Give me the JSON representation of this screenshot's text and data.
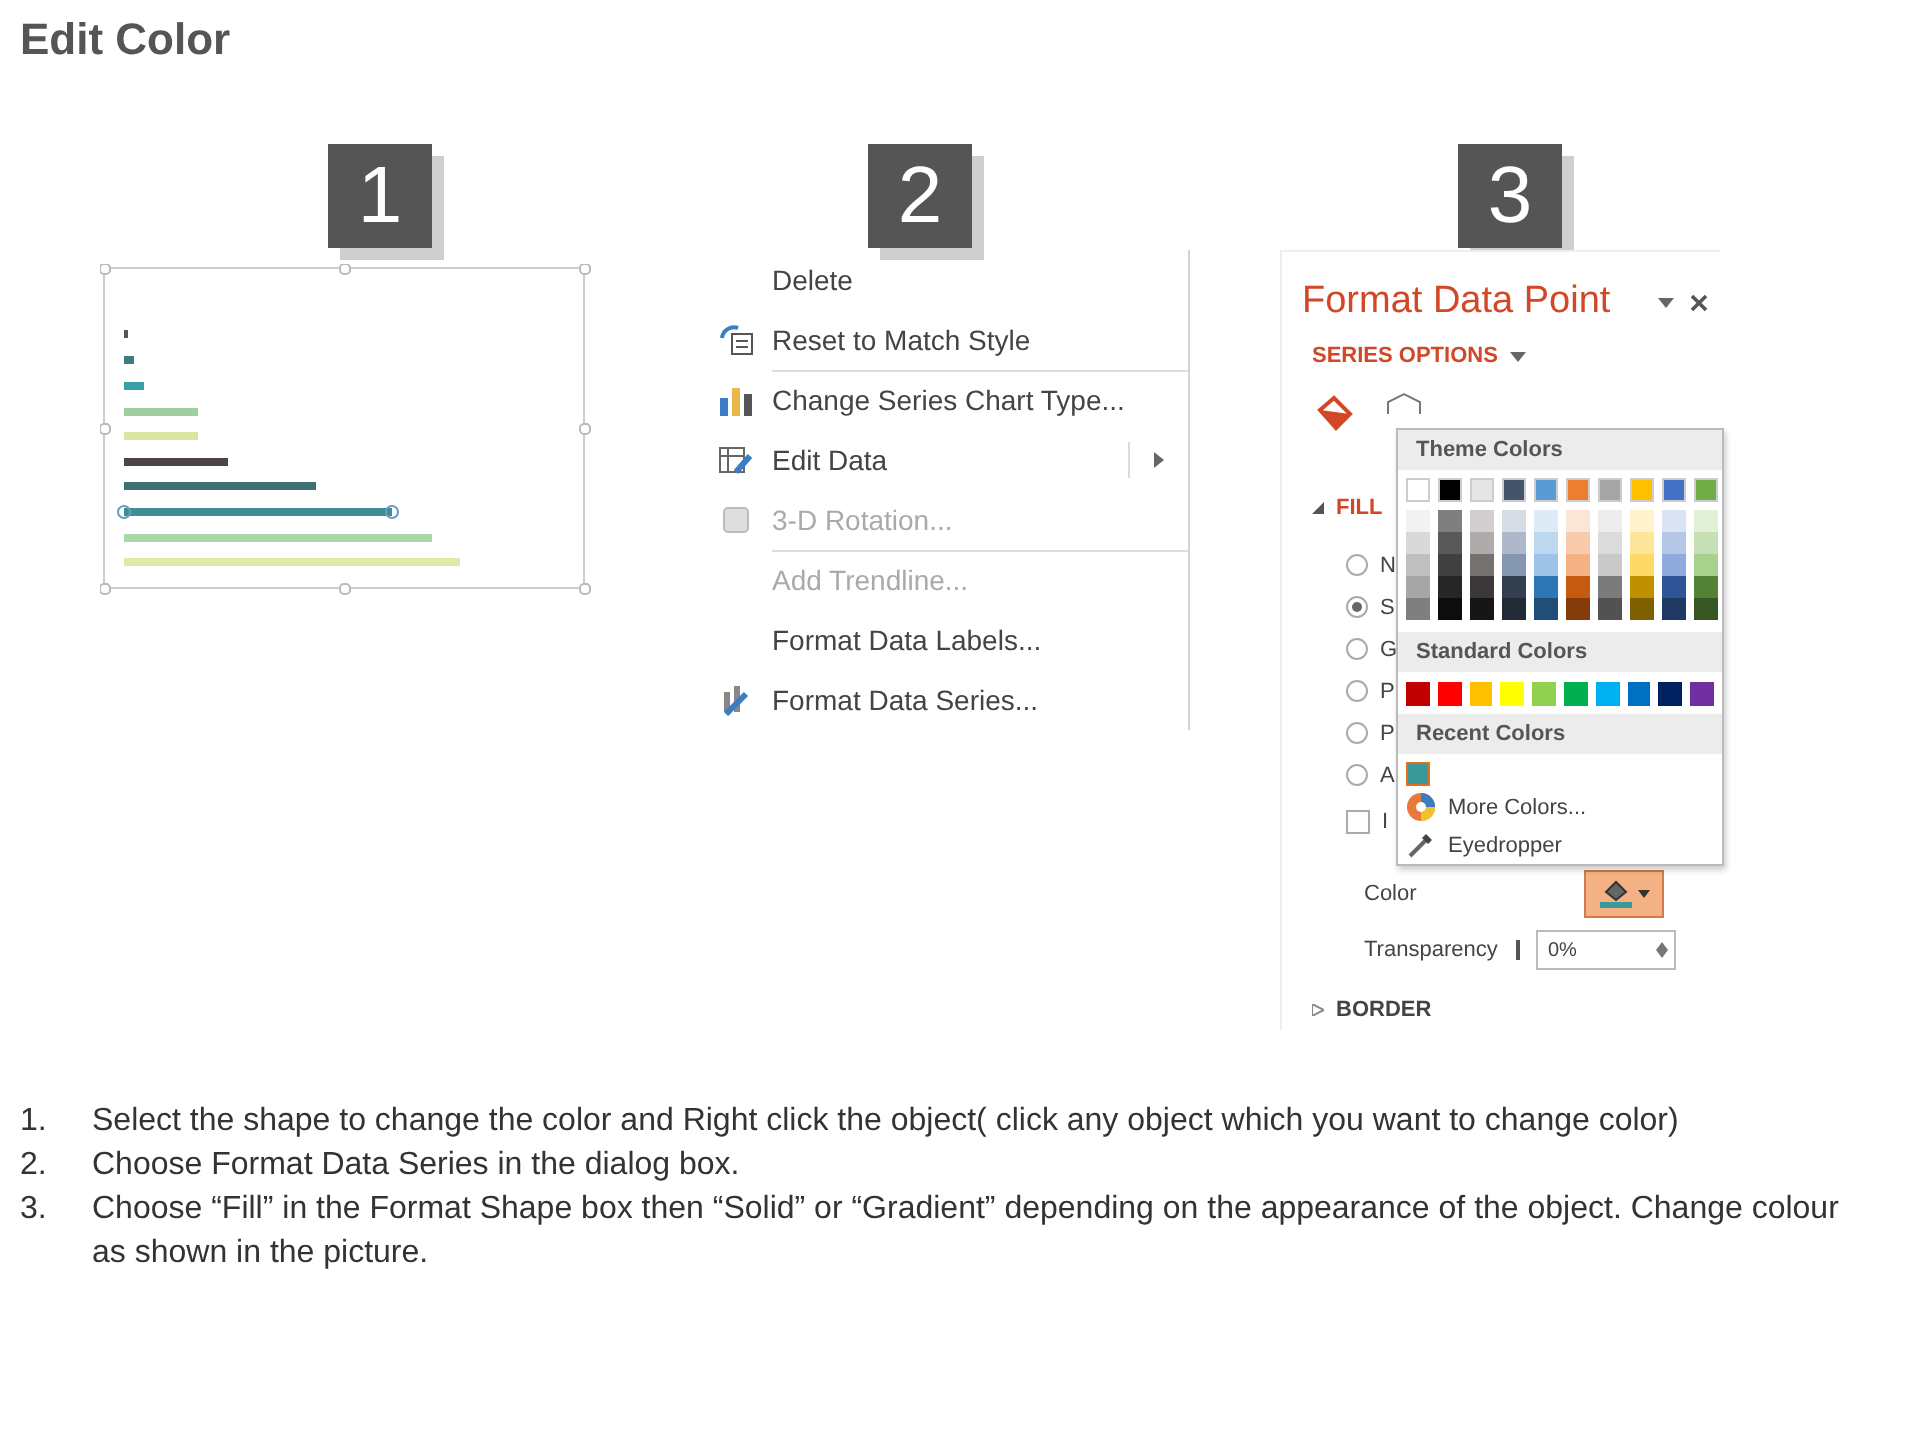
{
  "title": "Edit Color",
  "step_badges": [
    "1",
    "2",
    "3"
  ],
  "context_menu": {
    "items": [
      {
        "label": "Delete",
        "disabled": false,
        "separator_before": false,
        "submenu": false
      },
      {
        "label": "Reset to Match Style",
        "disabled": false,
        "separator_before": false,
        "submenu": false
      },
      {
        "label": "Change Series Chart Type...",
        "disabled": false,
        "separator_before": true,
        "submenu": false
      },
      {
        "label": "Edit Data",
        "disabled": false,
        "separator_before": false,
        "submenu": true
      },
      {
        "label": "3-D Rotation...",
        "disabled": true,
        "separator_before": false,
        "submenu": false
      },
      {
        "label": "Add Trendline...",
        "disabled": true,
        "separator_before": true,
        "submenu": false
      },
      {
        "label": "Format Data Labels...",
        "disabled": false,
        "separator_before": false,
        "submenu": false
      },
      {
        "label": "Format Data Series...",
        "disabled": false,
        "separator_before": false,
        "submenu": false
      }
    ]
  },
  "format_pane": {
    "title": "Format Data Point",
    "options_tab": "SERIES OPTIONS",
    "fill_section": {
      "label": "FILL",
      "expanded": true
    },
    "fill_options": [
      {
        "label": "N",
        "selected": false
      },
      {
        "label": "S",
        "selected": true
      },
      {
        "label": "G",
        "selected": false
      },
      {
        "label": "P",
        "selected": false
      },
      {
        "label": "P",
        "selected": false
      },
      {
        "label": "A",
        "selected": false
      }
    ],
    "invert_checkbox": {
      "label": "I",
      "checked": false
    },
    "color_label": "Color",
    "transparency_label": "Transparency",
    "transparency_value": "0%",
    "border_section": {
      "label": "BORDER",
      "expanded": false
    }
  },
  "color_menu": {
    "theme_header": "Theme Colors",
    "theme_colors": [
      {
        "color": "#ffffff",
        "shades": [
          {
            "color": "#f2f2f2"
          },
          {
            "color": "#d9d9d9"
          },
          {
            "color": "#bfbfbf"
          },
          {
            "color": "#a6a6a6"
          },
          {
            "color": "#7f7f7f"
          }
        ]
      },
      {
        "color": "#000000",
        "shades": [
          {
            "color": "#7f7f7f"
          },
          {
            "color": "#595959"
          },
          {
            "color": "#404040"
          },
          {
            "color": "#262626"
          },
          {
            "color": "#0d0d0d"
          }
        ]
      },
      {
        "color": "#e7e6e6",
        "shades": [
          {
            "color": "#d0cece"
          },
          {
            "color": "#aeabab"
          },
          {
            "color": "#757171"
          },
          {
            "color": "#3a3838"
          },
          {
            "color": "#171616"
          }
        ]
      },
      {
        "color": "#44546a",
        "shades": [
          {
            "color": "#d6dce4"
          },
          {
            "color": "#adb9ca"
          },
          {
            "color": "#8496b0"
          },
          {
            "color": "#333f4f"
          },
          {
            "color": "#222a35"
          }
        ]
      },
      {
        "color": "#5b9bd5",
        "shades": [
          {
            "color": "#deebf6"
          },
          {
            "color": "#bdd7ee"
          },
          {
            "color": "#9dc3e6"
          },
          {
            "color": "#2e75b5"
          },
          {
            "color": "#1f4e79"
          }
        ]
      },
      {
        "color": "#ed7d31",
        "shades": [
          {
            "color": "#fbe5d5"
          },
          {
            "color": "#f7cbac"
          },
          {
            "color": "#f4b183"
          },
          {
            "color": "#c55a11"
          },
          {
            "color": "#843c0b"
          }
        ]
      },
      {
        "color": "#a5a5a5",
        "shades": [
          {
            "color": "#ededed"
          },
          {
            "color": "#dbdbdb"
          },
          {
            "color": "#c9c9c9"
          },
          {
            "color": "#7b7b7b"
          },
          {
            "color": "#525252"
          }
        ]
      },
      {
        "color": "#ffc000",
        "shades": [
          {
            "color": "#fff2cc"
          },
          {
            "color": "#fee599"
          },
          {
            "color": "#ffd965"
          },
          {
            "color": "#bf9000"
          },
          {
            "color": "#7f6000"
          }
        ]
      },
      {
        "color": "#4472c4",
        "shades": [
          {
            "color": "#dae3f3"
          },
          {
            "color": "#b4c7e7"
          },
          {
            "color": "#8faadc"
          },
          {
            "color": "#2f5597"
          },
          {
            "color": "#203864"
          }
        ]
      },
      {
        "color": "#70ad47",
        "shades": [
          {
            "color": "#e2f0d9"
          },
          {
            "color": "#c5e0b4"
          },
          {
            "color": "#a9d18e"
          },
          {
            "color": "#538135"
          },
          {
            "color": "#375623"
          }
        ]
      }
    ],
    "standard_header": "Standard Colors",
    "standard_colors": [
      {
        "color": "#c00000"
      },
      {
        "color": "#ff0000"
      },
      {
        "color": "#ffc000"
      },
      {
        "color": "#ffff00"
      },
      {
        "color": "#92d050"
      },
      {
        "color": "#00b050"
      },
      {
        "color": "#00b0f0"
      },
      {
        "color": "#0070c0"
      },
      {
        "color": "#002060"
      },
      {
        "color": "#7030a0"
      }
    ],
    "recent_header": "Recent Colors",
    "recent_colors": [
      {
        "color": "#3a9a9a",
        "selected": true
      }
    ],
    "actions": [
      "More Colors...",
      "Eyedropper"
    ]
  },
  "instructions": [
    {
      "number": "1.",
      "text": "Select the shape to change the color and Right click the object( click any object which you want to change color)"
    },
    {
      "number": "2.",
      "text": "Choose Format Data Series in the dialog box."
    },
    {
      "number": "3.",
      "text": "Choose “Fill” in the Format Shape box then “Solid” or “Gradient” depending on the appearance of the object. Change colour as shown in the picture."
    }
  ]
}
